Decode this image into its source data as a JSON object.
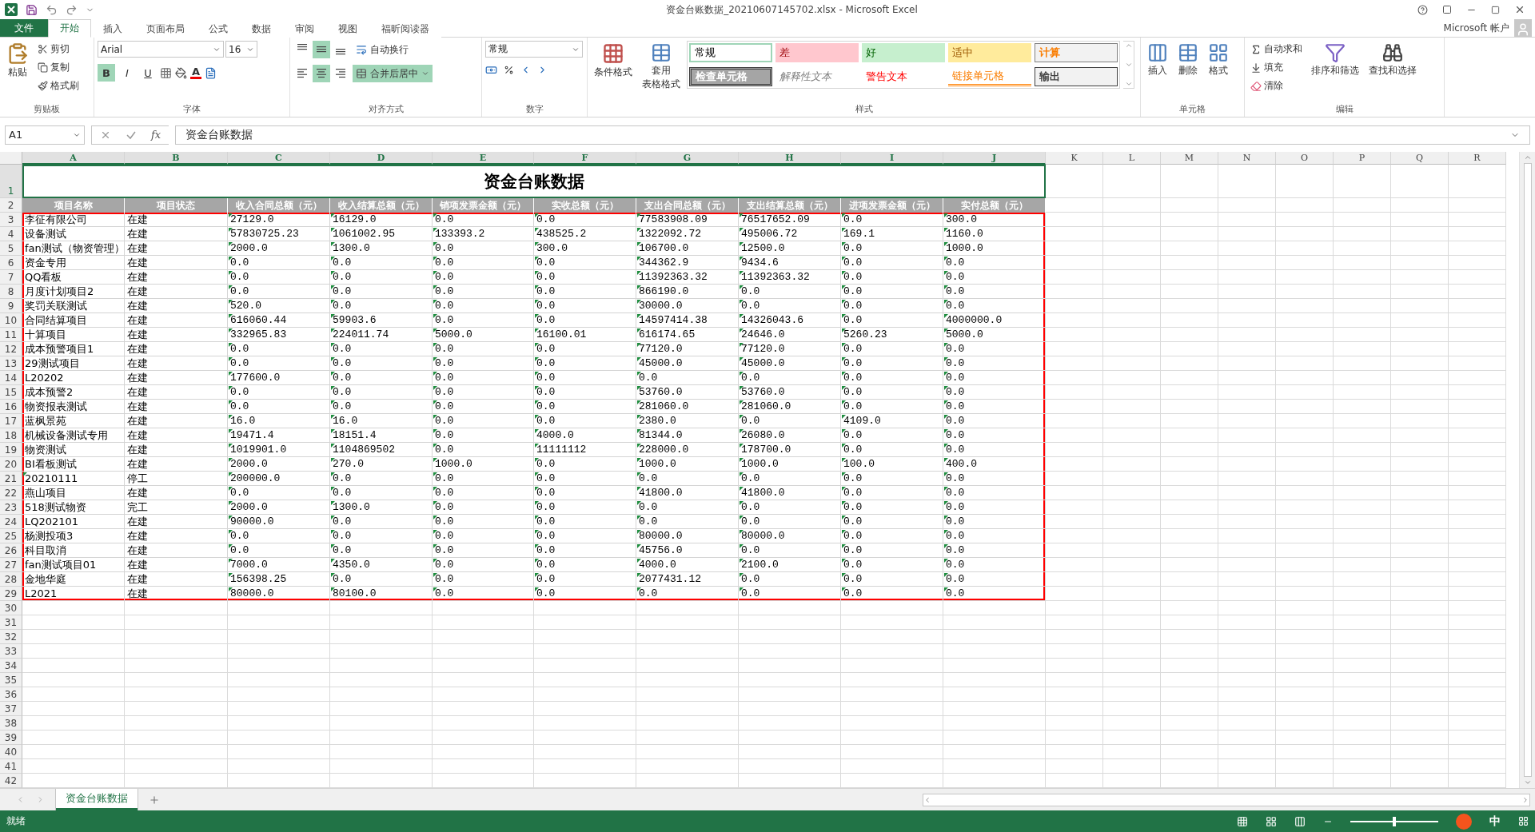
{
  "window": {
    "title": "资金台账数据_20210607145702.xlsx - Microsoft Excel",
    "account": "Microsoft 帐户"
  },
  "ribbon_tabs": [
    {
      "label": "文件",
      "kind": "file",
      "selected": false
    },
    {
      "label": "开始",
      "kind": "tab",
      "selected": true
    },
    {
      "label": "插入",
      "kind": "tab",
      "selected": false
    },
    {
      "label": "页面布局",
      "kind": "tab",
      "selected": false
    },
    {
      "label": "公式",
      "kind": "tab",
      "selected": false
    },
    {
      "label": "数据",
      "kind": "tab",
      "selected": false
    },
    {
      "label": "审阅",
      "kind": "tab",
      "selected": false
    },
    {
      "label": "视图",
      "kind": "tab",
      "selected": false
    },
    {
      "label": "福昕阅读器",
      "kind": "tab",
      "selected": false
    }
  ],
  "ribbon": {
    "clipboard": {
      "label": "剪贴板",
      "paste": "粘贴",
      "items": [
        "剪切",
        "复制",
        "格式刷"
      ]
    },
    "font": {
      "label": "字体",
      "font_name": "Arial",
      "font_size": "16",
      "styles": [
        {
          "label": "B",
          "kind": "bold",
          "selected": true
        },
        {
          "label": "I",
          "kind": "italic",
          "selected": false
        },
        {
          "label": "U",
          "kind": "underline",
          "selected": false
        }
      ],
      "font_color": "A"
    },
    "alignment": {
      "label": "对齐方式",
      "buttons": [
        {
          "kind": "top",
          "selected": false
        },
        {
          "kind": "middle",
          "selected": true
        },
        {
          "kind": "bottom",
          "selected": false
        },
        {
          "kind": "left",
          "selected": false
        },
        {
          "kind": "center",
          "selected": true
        },
        {
          "kind": "right",
          "selected": false
        }
      ],
      "wrap": {
        "label": "自动换行",
        "selected": false
      },
      "merge": {
        "label": "合并后居中",
        "selected": true
      }
    },
    "number": {
      "label": "数字",
      "format": "常规"
    },
    "styles": {
      "label": "样式",
      "conditional": "条件格式",
      "table_format": [
        "套用",
        "表格格式"
      ],
      "gallery": [
        {
          "label": "常规",
          "kind": "normal"
        },
        {
          "label": "差",
          "kind": "bad"
        },
        {
          "label": "好",
          "kind": "good"
        },
        {
          "label": "适中",
          "kind": "neutral"
        },
        {
          "label": "计算",
          "kind": "calc"
        },
        {
          "label": "检查单元格",
          "kind": "check"
        },
        {
          "label": "解释性文本",
          "kind": "explanatory"
        },
        {
          "label": "警告文本",
          "kind": "warning"
        },
        {
          "label": "链接单元格",
          "kind": "linked"
        },
        {
          "label": "输出",
          "kind": "output"
        }
      ]
    },
    "cells": {
      "label": "单元格",
      "buttons": [
        "插入",
        "删除",
        "格式"
      ]
    },
    "editing": {
      "label": "编辑",
      "items": [
        "自动求和",
        "填充",
        "清除"
      ],
      "sort": "排序和筛选",
      "find": "查找和选择"
    }
  },
  "formula_bar": {
    "name_box": "A1",
    "function_label": "fx",
    "value": "资金台账数据"
  },
  "sheet": {
    "columns": [
      "A",
      "B",
      "C",
      "D",
      "E",
      "F",
      "G",
      "H",
      "I",
      "J",
      "K",
      "L",
      "M",
      "N",
      "O",
      "P",
      "Q",
      "R"
    ],
    "row_numbers": [
      "1",
      "2",
      "3",
      "4",
      "5",
      "6",
      "7",
      "8",
      "9",
      "10",
      "11",
      "12",
      "13",
      "14",
      "15",
      "16",
      "17",
      "18",
      "19",
      "20",
      "21",
      "22",
      "23",
      "24",
      "25",
      "26",
      "27",
      "28",
      "29",
      "30",
      "31",
      "32",
      "33",
      "34",
      "35",
      "36",
      "37",
      "38",
      "39",
      "40",
      "41",
      "42"
    ],
    "title": "资金台账数据",
    "headers": [
      "项目名称",
      "项目状态",
      "收入合同总额（元）",
      "收入结算总额（元）",
      "销项发票金额（元）",
      "实收总额（元）",
      "支出合同总额（元）",
      "支出结算总额（元）",
      "进项发票金额（元）",
      "实付总额（元）"
    ],
    "rows": [
      {
        "name": "李征有限公司",
        "name_flagged": false,
        "status": "在建",
        "values": [
          "27129.0",
          "16129.0",
          "0.0",
          "0.0",
          "77583908.09",
          "76517652.09",
          "0.0",
          "300.0"
        ]
      },
      {
        "name": "设备测试",
        "name_flagged": false,
        "status": "在建",
        "values": [
          "57830725.23",
          "1061002.95",
          "133393.2",
          "438525.2",
          "1322092.72",
          "495006.72",
          "169.1",
          "1160.0"
        ]
      },
      {
        "name": "fan测试（物资管理）",
        "name_flagged": false,
        "status": "在建",
        "values": [
          "2000.0",
          "1300.0",
          "0.0",
          "300.0",
          "106700.0",
          "12500.0",
          "0.0",
          "1000.0"
        ]
      },
      {
        "name": "资金专用",
        "name_flagged": false,
        "status": "在建",
        "values": [
          "0.0",
          "0.0",
          "0.0",
          "0.0",
          "344362.9",
          "9434.6",
          "0.0",
          "0.0"
        ]
      },
      {
        "name": "QQ看板",
        "name_flagged": false,
        "status": "在建",
        "values": [
          "0.0",
          "0.0",
          "0.0",
          "0.0",
          "11392363.32",
          "11392363.32",
          "0.0",
          "0.0"
        ]
      },
      {
        "name": "月度计划项目2",
        "name_flagged": false,
        "status": "在建",
        "values": [
          "0.0",
          "0.0",
          "0.0",
          "0.0",
          "866190.0",
          "0.0",
          "0.0",
          "0.0"
        ]
      },
      {
        "name": "奖罚关联测试",
        "name_flagged": false,
        "status": "在建",
        "values": [
          "520.0",
          "0.0",
          "0.0",
          "0.0",
          "30000.0",
          "0.0",
          "0.0",
          "0.0"
        ]
      },
      {
        "name": "合同结算项目",
        "name_flagged": false,
        "status": "在建",
        "values": [
          "616060.44",
          "59903.6",
          "0.0",
          "0.0",
          "14597414.38",
          "14326043.6",
          "0.0",
          "4000000.0"
        ]
      },
      {
        "name": "十算项目",
        "name_flagged": false,
        "status": "在建",
        "values": [
          "332965.83",
          "224011.74",
          "5000.0",
          "16100.01",
          "616174.65",
          "24646.0",
          "5260.23",
          "5000.0"
        ]
      },
      {
        "name": "成本预警项目1",
        "name_flagged": false,
        "status": "在建",
        "values": [
          "0.0",
          "0.0",
          "0.0",
          "0.0",
          "77120.0",
          "77120.0",
          "0.0",
          "0.0"
        ]
      },
      {
        "name": "29测试项目",
        "name_flagged": false,
        "status": "在建",
        "values": [
          "0.0",
          "0.0",
          "0.0",
          "0.0",
          "45000.0",
          "45000.0",
          "0.0",
          "0.0"
        ]
      },
      {
        "name": "L20202",
        "name_flagged": false,
        "status": "在建",
        "values": [
          "177600.0",
          "0.0",
          "0.0",
          "0.0",
          "0.0",
          "0.0",
          "0.0",
          "0.0"
        ]
      },
      {
        "name": "成本预警2",
        "name_flagged": false,
        "status": "在建",
        "values": [
          "0.0",
          "0.0",
          "0.0",
          "0.0",
          "53760.0",
          "53760.0",
          "0.0",
          "0.0"
        ]
      },
      {
        "name": "物资报表测试",
        "name_flagged": false,
        "status": "在建",
        "values": [
          "0.0",
          "0.0",
          "0.0",
          "0.0",
          "281060.0",
          "281060.0",
          "0.0",
          "0.0"
        ]
      },
      {
        "name": "蓝枫景苑",
        "name_flagged": false,
        "status": "在建",
        "values": [
          "16.0",
          "16.0",
          "0.0",
          "0.0",
          "2380.0",
          "0.0",
          "4109.0",
          "0.0"
        ]
      },
      {
        "name": "机械设备测试专用",
        "name_flagged": false,
        "status": "在建",
        "values": [
          "19471.4",
          "18151.4",
          "0.0",
          "4000.0",
          "81344.0",
          "26080.0",
          "0.0",
          "0.0"
        ]
      },
      {
        "name": "物资测试",
        "name_flagged": false,
        "status": "在建",
        "values": [
          "1019901.0",
          "1104869502",
          "0.0",
          "11111112",
          "228000.0",
          "178700.0",
          "0.0",
          "0.0"
        ]
      },
      {
        "name": "BI看板测试",
        "name_flagged": false,
        "status": "在建",
        "values": [
          "2000.0",
          "270.0",
          "1000.0",
          "0.0",
          "1000.0",
          "1000.0",
          "100.0",
          "400.0"
        ]
      },
      {
        "name": "20210111",
        "name_flagged": true,
        "status": "停工",
        "values": [
          "200000.0",
          "0.0",
          "0.0",
          "0.0",
          "0.0",
          "0.0",
          "0.0",
          "0.0"
        ]
      },
      {
        "name": "燕山项目",
        "name_flagged": false,
        "status": "在建",
        "values": [
          "0.0",
          "0.0",
          "0.0",
          "0.0",
          "41800.0",
          "41800.0",
          "0.0",
          "0.0"
        ]
      },
      {
        "name": "518测试物资",
        "name_flagged": false,
        "status": "完工",
        "values": [
          "2000.0",
          "1300.0",
          "0.0",
          "0.0",
          "0.0",
          "0.0",
          "0.0",
          "0.0"
        ]
      },
      {
        "name": "LQ202101",
        "name_flagged": false,
        "status": "在建",
        "values": [
          "90000.0",
          "0.0",
          "0.0",
          "0.0",
          "0.0",
          "0.0",
          "0.0",
          "0.0"
        ]
      },
      {
        "name": "杨测投项3",
        "name_flagged": false,
        "status": "在建",
        "values": [
          "0.0",
          "0.0",
          "0.0",
          "0.0",
          "80000.0",
          "80000.0",
          "0.0",
          "0.0"
        ]
      },
      {
        "name": "科目取消",
        "name_flagged": false,
        "status": "在建",
        "values": [
          "0.0",
          "0.0",
          "0.0",
          "0.0",
          "45756.0",
          "0.0",
          "0.0",
          "0.0"
        ]
      },
      {
        "name": "fan测试项目01",
        "name_flagged": false,
        "status": "在建",
        "values": [
          "7000.0",
          "4350.0",
          "0.0",
          "0.0",
          "4000.0",
          "2100.0",
          "0.0",
          "0.0"
        ]
      },
      {
        "name": "金地华庭",
        "name_flagged": false,
        "status": "在建",
        "values": [
          "156398.25",
          "0.0",
          "0.0",
          "0.0",
          "2077431.12",
          "0.0",
          "0.0",
          "0.0"
        ]
      },
      {
        "name": "L2021",
        "name_flagged": false,
        "status": "在建",
        "values": [
          "80000.0",
          "80100.0",
          "0.0",
          "0.0",
          "0.0",
          "0.0",
          "0.0",
          "0.0"
        ]
      }
    ]
  },
  "sheet_tabs": [
    {
      "label": "资金台账数据",
      "selected": true
    }
  ],
  "status_bar": {
    "text": "就绪",
    "zoom": {
      "level": 0.5
    },
    "ime": "中"
  }
}
